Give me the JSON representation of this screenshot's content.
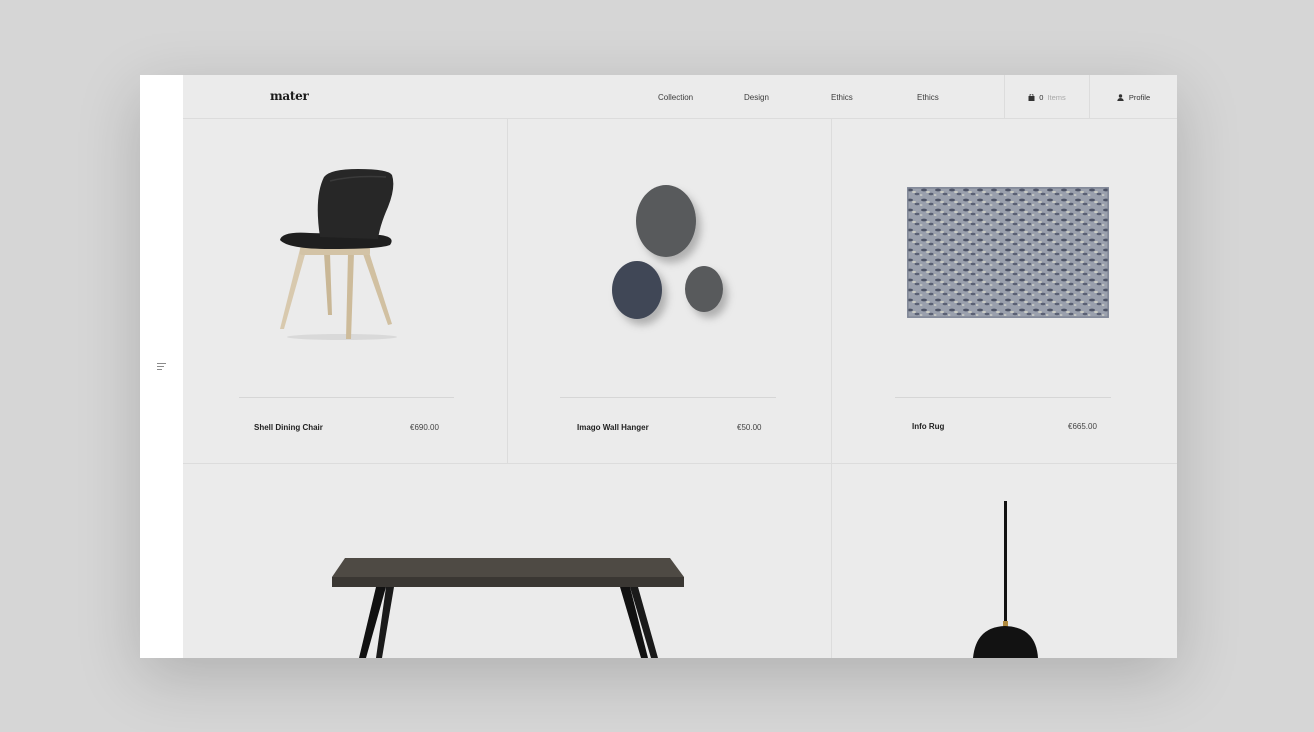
{
  "brand": {
    "logo": "mater"
  },
  "nav": {
    "items": [
      {
        "label": "Collection"
      },
      {
        "label": "Design"
      },
      {
        "label": "Ethics"
      },
      {
        "label": "Ethics"
      }
    ]
  },
  "cart": {
    "count": "0",
    "label": "Items",
    "icon": "bag-icon"
  },
  "profile": {
    "label": "Profile",
    "icon": "user-icon"
  },
  "sidebar": {
    "icon": "menu-icon"
  },
  "products": [
    {
      "name": "Shell Dining Chair",
      "price": "€690.00"
    },
    {
      "name": "Imago Wall Hanger",
      "price": "€50.00"
    },
    {
      "name": "Info Rug",
      "price": "€665.00"
    }
  ],
  "colors": {
    "background": "#d6d6d6",
    "panel": "#ebebeb",
    "rail": "#ffffff",
    "text": "#222222",
    "muted": "#a8a8a8"
  }
}
